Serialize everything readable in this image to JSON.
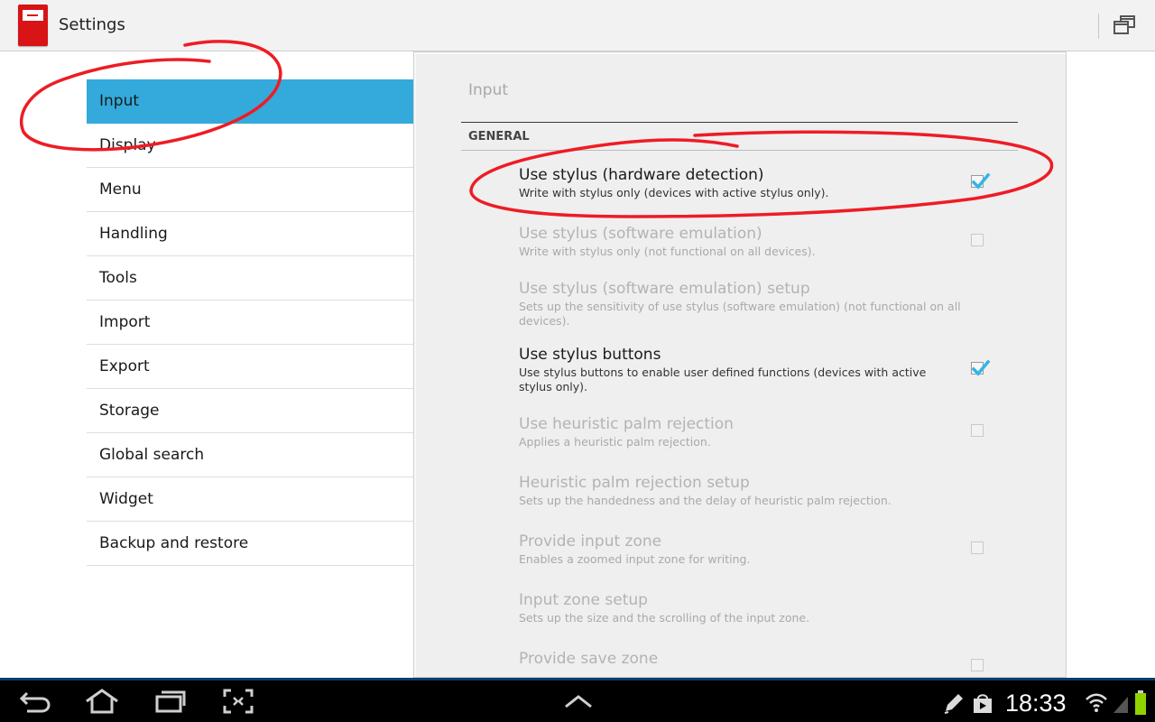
{
  "app": {
    "title": "Settings",
    "icon": "notebook-app-icon",
    "window_button_icon": "restore-window-icon"
  },
  "sidebar": {
    "items": [
      {
        "label": "Input",
        "selected": true
      },
      {
        "label": "Display",
        "selected": false
      },
      {
        "label": "Menu",
        "selected": false
      },
      {
        "label": "Handling",
        "selected": false
      },
      {
        "label": "Tools",
        "selected": false
      },
      {
        "label": "Import",
        "selected": false
      },
      {
        "label": "Export",
        "selected": false
      },
      {
        "label": "Storage",
        "selected": false
      },
      {
        "label": "Global search",
        "selected": false
      },
      {
        "label": "Widget",
        "selected": false
      },
      {
        "label": "Backup and restore",
        "selected": false
      }
    ]
  },
  "panel": {
    "title": "Input",
    "category": "GENERAL",
    "prefs": [
      {
        "title": "Use stylus (hardware detection)",
        "summary": "Write with stylus only (devices with active stylus only).",
        "enabled": true,
        "checkbox": true,
        "checked": true
      },
      {
        "title": "Use stylus (software emulation)",
        "summary": "Write with stylus only (not functional on all devices).",
        "enabled": false,
        "checkbox": true,
        "checked": false
      },
      {
        "title": "Use stylus (software emulation) setup",
        "summary": "Sets up the sensitivity of use stylus (software emulation) (not functional on all devices).",
        "enabled": false,
        "checkbox": false,
        "checked": false
      },
      {
        "title": "Use stylus buttons",
        "summary": "Use stylus buttons to enable user defined functions (devices with active stylus only).",
        "enabled": true,
        "checkbox": true,
        "checked": true
      },
      {
        "title": "Use heuristic palm rejection",
        "summary": "Applies a heuristic palm rejection.",
        "enabled": false,
        "checkbox": true,
        "checked": false
      },
      {
        "title": "Heuristic palm rejection setup",
        "summary": "Sets up the handedness and the delay of heuristic palm rejection.",
        "enabled": false,
        "checkbox": false,
        "checked": false
      },
      {
        "title": "Provide input zone",
        "summary": "Enables a zoomed input zone for writing.",
        "enabled": false,
        "checkbox": true,
        "checked": false
      },
      {
        "title": "Input zone setup",
        "summary": "Sets up the size and the scrolling of the input zone.",
        "enabled": false,
        "checkbox": false,
        "checked": false
      },
      {
        "title": "Provide save zone",
        "summary": "",
        "enabled": false,
        "checkbox": true,
        "checked": false
      }
    ]
  },
  "system_bar": {
    "clock": "18:33",
    "left_icons": [
      "back-icon",
      "home-icon",
      "recent-apps-icon",
      "screenshot-icon"
    ],
    "center_icon": "chevron-up-icon",
    "right_icons": [
      "pen-icon",
      "store-bag-icon",
      "wifi-icon",
      "signal-icon",
      "battery-icon"
    ]
  },
  "colors": {
    "accent": "#33aadb",
    "checkmark": "#33b5e5",
    "annotation": "#ee1c24",
    "app_icon": "#d81416"
  }
}
